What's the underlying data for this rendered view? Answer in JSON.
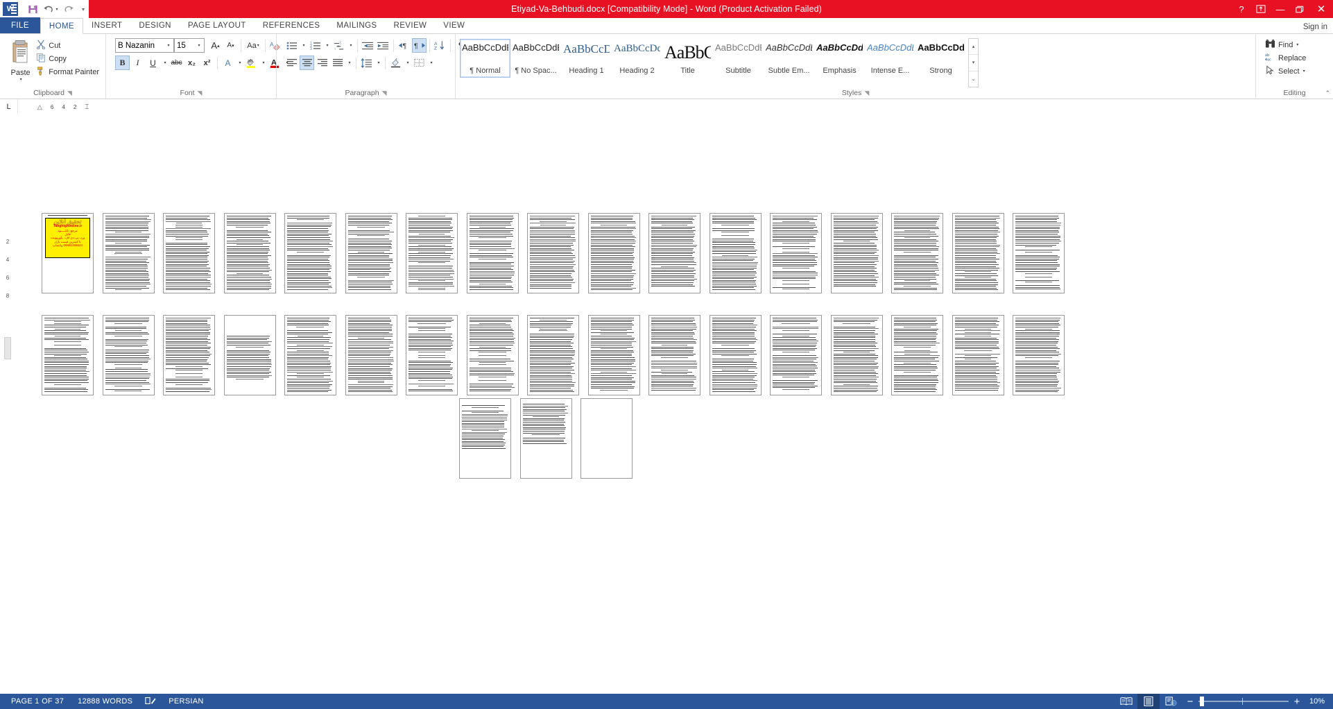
{
  "titlebar": {
    "title": "Etiyad-Va-Behbudi.docx [Compatibility Mode]  -  Word (Product Activation Failed)",
    "accent_color": "#e81123",
    "quick_access": [
      {
        "name": "word-logo-icon",
        "label": "W"
      },
      {
        "name": "save-icon",
        "label": "save"
      },
      {
        "name": "undo-icon",
        "label": "undo"
      },
      {
        "name": "redo-icon",
        "label": "redo"
      },
      {
        "name": "customize-qat-icon",
        "label": "more"
      }
    ],
    "help_label": "?",
    "ribbon_display_label": "ribbon-options",
    "minimize_label": "minimize",
    "restore_label": "restore",
    "close_label": "close"
  },
  "tabs": {
    "file": "FILE",
    "items": [
      {
        "label": "HOME",
        "active": true
      },
      {
        "label": "INSERT",
        "active": false
      },
      {
        "label": "DESIGN",
        "active": false
      },
      {
        "label": "PAGE LAYOUT",
        "active": false
      },
      {
        "label": "REFERENCES",
        "active": false
      },
      {
        "label": "MAILINGS",
        "active": false
      },
      {
        "label": "REVIEW",
        "active": false
      },
      {
        "label": "VIEW",
        "active": false
      }
    ],
    "signin": "Sign in"
  },
  "ribbon": {
    "clipboard": {
      "label": "Clipboard",
      "paste": "Paste",
      "cut": "Cut",
      "copy": "Copy",
      "format_painter": "Format Painter"
    },
    "font": {
      "label": "Font",
      "font_name": "B Nazanin",
      "font_size": "15",
      "grow_font": "A",
      "shrink_font": "A",
      "change_case": "Aa",
      "clear_formatting": "clear-formatting",
      "bold": "B",
      "italic": "I",
      "underline": "U",
      "strikethrough": "abc",
      "subscript": "x₂",
      "superscript": "x²",
      "text_effects": "A",
      "highlight": "highlight",
      "font_color": "A",
      "bold_active": true
    },
    "paragraph": {
      "label": "Paragraph",
      "bullets": "bullets",
      "numbering": "numbering",
      "multilevel": "multilevel-list",
      "decrease_indent": "decrease-indent",
      "increase_indent": "increase-indent",
      "ltr": "left-to-right",
      "rtl": "right-to-left",
      "sort": "sort",
      "show_marks": "show-formatting-marks",
      "align_left": "align-left",
      "align_center": "align-center",
      "align_right": "align-right",
      "justify": "justify",
      "line_spacing": "line-spacing",
      "shading": "shading",
      "borders": "borders",
      "center_active": true,
      "rtl_active": true
    },
    "styles": {
      "label": "Styles",
      "items": [
        {
          "preview": "AaBbCcDdEe",
          "name": "¶ Normal",
          "selected": true,
          "kind": "normal"
        },
        {
          "preview": "AaBbCcDdEe",
          "name": "¶ No Spac...",
          "selected": false,
          "kind": "normal"
        },
        {
          "preview": "AaBbCcDdEe",
          "name": "Heading 1",
          "selected": false,
          "kind": "heading1"
        },
        {
          "preview": "AaBbCcDdEe",
          "name": "Heading 2",
          "selected": false,
          "kind": "heading2"
        },
        {
          "preview": "AaBbCcDdEe",
          "name": "Title",
          "selected": false,
          "kind": "title"
        },
        {
          "preview": "AaBbCcDdEe",
          "name": "Subtitle",
          "selected": false,
          "kind": "subtitle"
        },
        {
          "preview": "AaBbCcDdEe",
          "name": "Subtle Em...",
          "selected": false,
          "kind": "subtle-em"
        },
        {
          "preview": "AaBbCcDdEe",
          "name": "Emphasis",
          "selected": false,
          "kind": "emphasis"
        },
        {
          "preview": "AaBbCcDdEe",
          "name": "Intense E...",
          "selected": false,
          "kind": "intense-em"
        },
        {
          "preview": "AaBbCcDdEe",
          "name": "Strong",
          "selected": false,
          "kind": "strong"
        }
      ]
    },
    "editing": {
      "label": "Editing",
      "find": "Find",
      "replace": "Replace",
      "select": "Select"
    },
    "collapse_ribbon": "collapse-ribbon"
  },
  "ruler": {
    "tab_selector": "L",
    "marks": [
      "6",
      "4",
      "2"
    ],
    "vertical_marks": [
      "2",
      "4",
      "6",
      "8"
    ]
  },
  "document": {
    "cover": {
      "title_fa": "تحقیق آنلاین",
      "site": "Tahghighonline.ir",
      "line1": "مرجع دانلـــــود",
      "line2": "فایل",
      "line3": "ورد، پی دی اف ، پاورپوینت",
      "line4": "با کمترین قیمت بازار",
      "line5": "09581366624 واتساپ"
    },
    "zoom_percent": "10%",
    "row_counts": [
      17,
      17,
      3
    ],
    "total_pages": 37
  },
  "statusbar": {
    "page": "PAGE 1 OF 37",
    "words": "12888 WORDS",
    "proofing": "proofing-icon",
    "language": "PERSIAN",
    "view_read": "read-mode-icon",
    "view_print": "print-layout-icon",
    "view_web": "web-layout-icon",
    "zoom_out": "−",
    "zoom_in": "+",
    "zoom_value": "10%",
    "accent_color": "#2b579a"
  }
}
